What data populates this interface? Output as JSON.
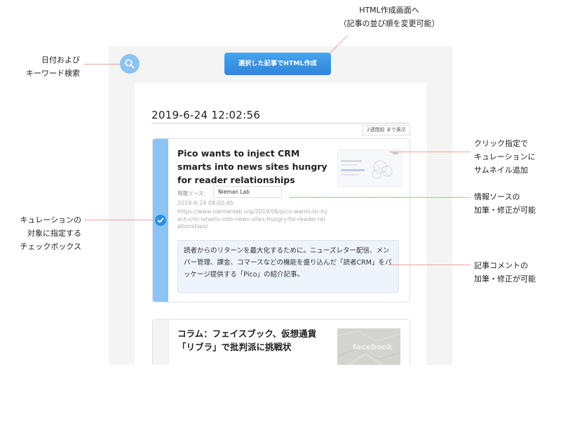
{
  "toolbar": {
    "create_label": "選択した記事でHTML作成"
  },
  "header": {
    "timestamp": "2019-6-24 12:02:56",
    "range_label": "2週間前 まで表示"
  },
  "articles": [
    {
      "title": "Pico wants to inject CRM smarts into news sites hungry for reader relationships",
      "source_label": "情報ソース：",
      "source": "Nieman Lab",
      "date": "2019-6-24 08:02:45",
      "url": "https://www.niemanlab.org/2019/06/pico-wants-to-inject-crm-smarts-into-news-sites-hungry-for-reader-relationships/",
      "comment": "読者からのリターンを最大化するために。ニューズレター配信、メンバー管理、課金、コマースなどの機能を盛り込んだ「読者CRM」をパッケージ提供する「Pico」の紹介記事。",
      "selected": true
    },
    {
      "title": "コラム：フェイスブック、仮想通貨「リブラ」で批判派に挑戦状",
      "thumbnail_text": "facebook",
      "selected": false
    }
  ],
  "annotations": {
    "search": [
      "日付および",
      "キーワード検索"
    ],
    "html": [
      "HTML作成画面へ",
      "（記事の並び順を変更可能）"
    ],
    "thumbnail": [
      "クリック指定で",
      "キュレーションに",
      "サムネイル追加"
    ],
    "source": [
      "情報ソースの",
      "加筆・修正が可能"
    ],
    "checkbox": [
      "キュレーションの",
      "対象に指定する",
      "チェックボックス"
    ],
    "comment": [
      "記事コメントの",
      "加筆・修正が可能"
    ]
  },
  "colors": {
    "accent": "#2e8ee0",
    "selected_bar": "#8cc3f2",
    "annotation_line": "#e24c3c"
  }
}
